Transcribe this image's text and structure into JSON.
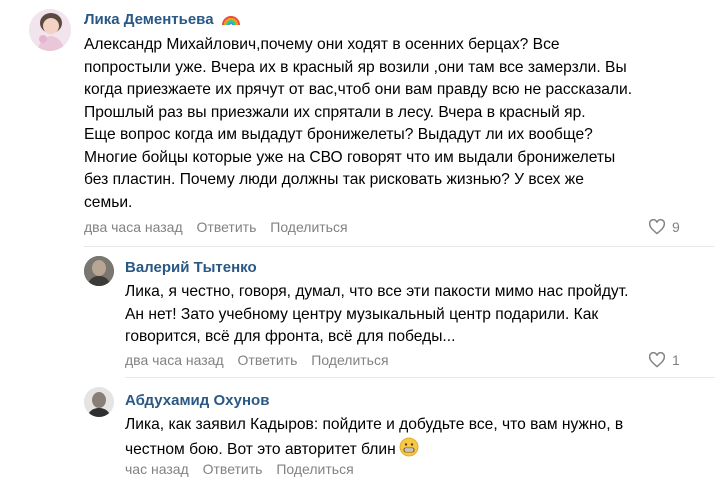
{
  "comments": [
    {
      "author": "Лика Дементьева",
      "text": "Александр Михайлович,почему они ходят в осенних берцах? Все\nпопростыли уже. Вчера их в красный яр возили ,они там все замерзли. Вы\nкогда приезжаете их прячут от вас,чтоб они вам правду всю не рассказали.\nПрошлый раз вы приезжали их спрятали в лесу. Вчера в красный яр.\nЕще вопрос когда им выдадут бронижелеты? Выдадут ли их вообще?\nМногие бойцы которые уже на СВО говорят что им выдали бронижелеты\nбез пластин. Почему люди должны так рисковать жизнью? У всех же\nсемьи.",
      "time": "два часа назад",
      "reply": "Ответить",
      "share": "Поделиться",
      "likes": "9"
    },
    {
      "author": "Валерий Тытенко",
      "text": "Лика, я честно, говоря, думал, что все эти пакости мимо нас пройдут.\nАн нет! Зато учебному центру музыкальный центр подарили. Как\nговорится, всё для фронта, всё для победы...",
      "time": "два часа назад",
      "reply": "Ответить",
      "share": "Поделиться",
      "likes": "1"
    },
    {
      "author": "Абдухамид Охунов",
      "text": "Лика, как заявил Кадыров: пойдите и добудьте все, что вам нужно, в\nчестном бою. Вот это авторитет блин",
      "time": "час назад",
      "reply": "Ответить",
      "share": "Поделиться"
    }
  ],
  "icons": {
    "rainbow": "rainbow-emoji-icon",
    "heart": "heart-icon",
    "grimace": "grimacing-face-emoji-icon"
  },
  "colors": {
    "author": "#2a5885",
    "meta": "#828282",
    "divider": "#e7e8ec"
  }
}
